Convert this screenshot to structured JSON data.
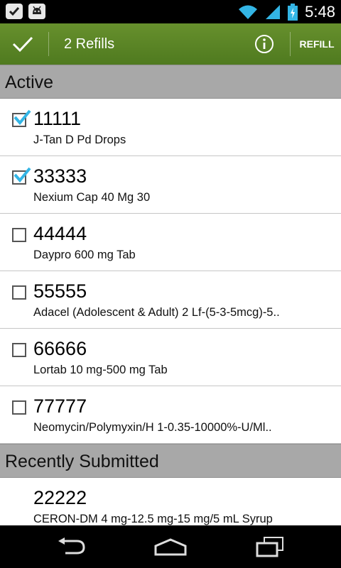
{
  "status_bar": {
    "time": "5:48",
    "icons": [
      "check-notification-icon",
      "android-notification-icon",
      "wifi-icon",
      "signal-icon",
      "battery-charging-icon"
    ]
  },
  "action_bar": {
    "title": "2 Refills",
    "refill_label": "REFILL",
    "color": "#5a8526",
    "icons": [
      "done-check-icon",
      "info-icon"
    ]
  },
  "sections": {
    "active": {
      "header": "Active",
      "items": [
        {
          "number": "11111",
          "name": "J-Tan D Pd Drops",
          "checked": true
        },
        {
          "number": "33333",
          "name": "Nexium Cap  40 Mg  30",
          "checked": true
        },
        {
          "number": "44444",
          "name": "Daypro 600 mg Tab",
          "checked": false
        },
        {
          "number": "55555",
          "name": "Adacel (Adolescent & Adult) 2 Lf-(5-3-5mcg)-5..",
          "checked": false
        },
        {
          "number": "66666",
          "name": "Lortab 10 mg-500 mg Tab",
          "checked": false
        },
        {
          "number": "77777",
          "name": "Neomycin/Polymyxin/H 1-0.35-10000%-U/Ml..",
          "checked": false
        }
      ]
    },
    "recent": {
      "header": "Recently Submitted",
      "items": [
        {
          "number": "22222",
          "name": "CERON-DM 4 mg-12.5 mg-15 mg/5 mL Syrup"
        }
      ]
    }
  },
  "nav_bar": {
    "icons": [
      "back-icon",
      "home-icon",
      "recent-apps-icon"
    ]
  },
  "colors": {
    "check_accent": "#33b5e5",
    "section_header_bg": "#a8a8a8"
  }
}
